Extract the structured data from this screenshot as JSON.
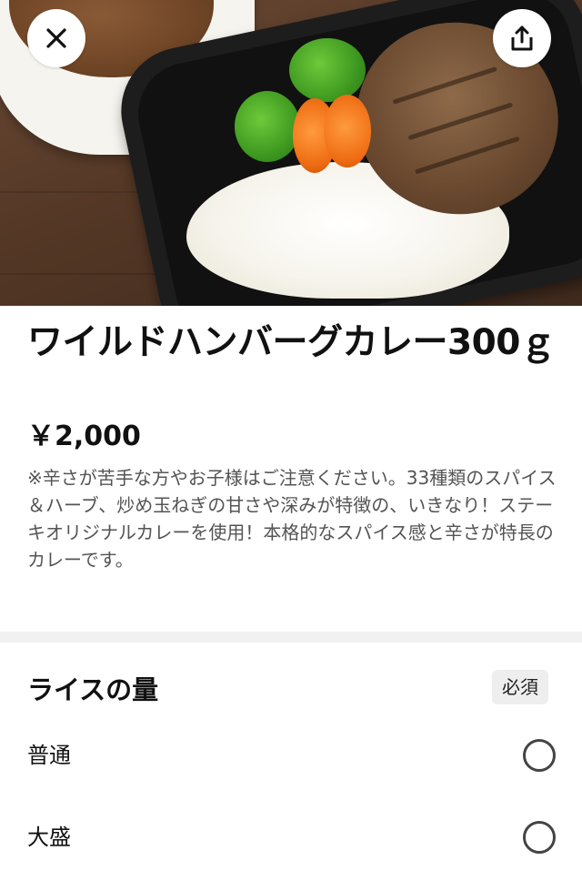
{
  "header": {
    "close_icon": "close-icon",
    "share_icon": "share-icon"
  },
  "product": {
    "title": "ワイルドハンバーグカレー300ｇ",
    "price": "￥2,000",
    "description": "※辛さが苦手な方やお子様はご注意ください。33種類のスパイス＆ハーブ、炒め玉ねぎの甘さや深みが特徴の、いきなり！ステーキオリジナルカレーを使用！本格的なスパイス感と辛さが特長のカレーです。"
  },
  "rice_section": {
    "title": "ライスの量",
    "badge": "必須",
    "options": [
      {
        "label": "普通",
        "selected": false
      },
      {
        "label": "大盛",
        "selected": false
      }
    ]
  }
}
